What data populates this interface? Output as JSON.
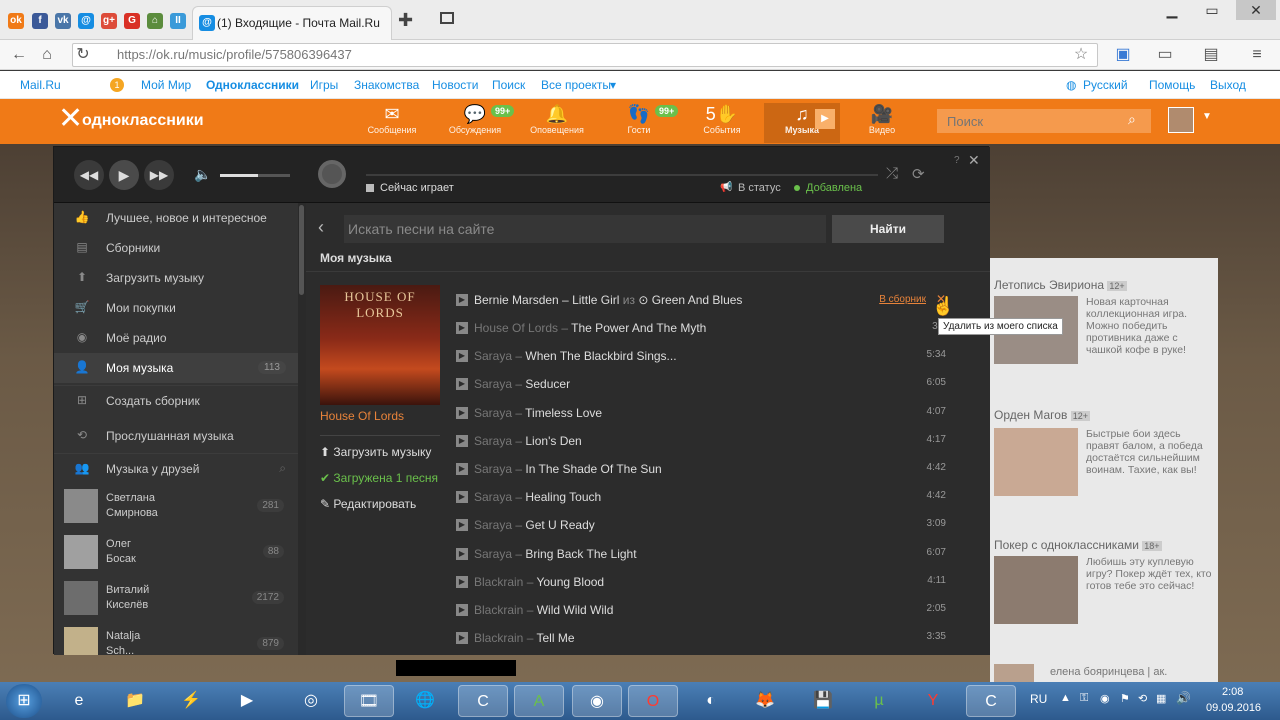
{
  "tabs": {
    "active_title": "(1) Входящие - Почта Mail.Ru"
  },
  "address": {
    "url": "https://ok.ru/music/profile/575806396437"
  },
  "mailbar": {
    "links": [
      "Mail.Ru",
      "Мой Мир",
      "Одноклассники",
      "Игры",
      "Знакомства",
      "Новости",
      "Поиск",
      "Все проекты"
    ],
    "language": "Русский",
    "help": "Помощь",
    "exit": "Выход"
  },
  "ok_header": {
    "logo": "одноклассники",
    "nav": [
      {
        "label": "Сообщения",
        "icon": "envelope-icon",
        "badge": ""
      },
      {
        "label": "Обсуждения",
        "icon": "chat-icon",
        "badge": "99+"
      },
      {
        "label": "Оповещения",
        "icon": "bell-icon",
        "badge": ""
      },
      {
        "label": "Гости",
        "icon": "footprints-icon",
        "badge": "99+"
      },
      {
        "label": "События",
        "icon": "events-icon",
        "badge": ""
      },
      {
        "label": "Музыка",
        "icon": "music-note-icon",
        "badge": ""
      },
      {
        "label": "Видео",
        "icon": "video-camera-icon",
        "badge": ""
      }
    ],
    "events_count": "5",
    "search_placeholder": "Поиск"
  },
  "player": {
    "now_playing": "Сейчас играет",
    "to_status": "В статус",
    "added": "Добавлена"
  },
  "sidebar": {
    "items": [
      {
        "label": "Лучшее, новое и интересное",
        "icon": "thumbs-up-icon"
      },
      {
        "label": "Сборники",
        "icon": "collection-icon"
      },
      {
        "label": "Загрузить музыку",
        "icon": "upload-icon"
      },
      {
        "label": "Мои покупки",
        "icon": "cart-icon"
      },
      {
        "label": "Моё радио",
        "icon": "radio-icon"
      },
      {
        "label": "Моя музыка",
        "icon": "user-music-icon",
        "count": "113"
      },
      {
        "label": "Создать сборник",
        "icon": "plus-square-icon"
      },
      {
        "label": "Прослушанная музыка",
        "icon": "history-icon"
      },
      {
        "label": "Музыка у друзей",
        "icon": "friends-icon"
      }
    ],
    "friends": [
      {
        "name1": "Светлана",
        "name2": "Смирнова",
        "count": "281"
      },
      {
        "name1": "Олег",
        "name2": "Босак",
        "count": "88"
      },
      {
        "name1": "Виталий",
        "name2": "Киселёв",
        "count": "2172"
      },
      {
        "name1": "Natalja",
        "name2": "Sch...",
        "count": "879"
      }
    ]
  },
  "content": {
    "search_placeholder": "Искать песни на сайте",
    "find_label": "Найти",
    "section_title": "Моя музыка",
    "album_art_text": "HOUSE OF LORDS",
    "album_name": "House Of Lords",
    "upload_label": "Загрузить музыку",
    "uploaded_label": "Загружена 1 песня",
    "edit_label": "Редактировать",
    "first_track": {
      "artist": "Bernie Marsden",
      "title": "Little Girl",
      "from": "из",
      "album": "Green And Blues",
      "to_collection": "В сборник"
    },
    "tooltip": "Удалить из моего списка",
    "tracks": [
      {
        "artist": "House Of Lords",
        "title": "The Power And The Myth",
        "duration": "3:2"
      },
      {
        "artist": "Saraya",
        "title": "When The Blackbird Sings...",
        "duration": "5:34"
      },
      {
        "artist": "Saraya",
        "title": "Seducer",
        "duration": "6:05"
      },
      {
        "artist": "Saraya",
        "title": "Timeless Love",
        "duration": "4:07"
      },
      {
        "artist": "Saraya",
        "title": "Lion's Den",
        "duration": "4:17"
      },
      {
        "artist": "Saraya",
        "title": "In The Shade Of The Sun",
        "duration": "4:42"
      },
      {
        "artist": "Saraya",
        "title": "Healing Touch",
        "duration": "4:42"
      },
      {
        "artist": "Saraya",
        "title": "Get U Ready",
        "duration": "3:09"
      },
      {
        "artist": "Saraya",
        "title": "Bring Back The Light",
        "duration": "6:07"
      },
      {
        "artist": "Blackrain",
        "title": "Young Blood",
        "duration": "4:11"
      },
      {
        "artist": "Blackrain",
        "title": "Wild Wild Wild",
        "duration": "2:05"
      },
      {
        "artist": "Blackrain",
        "title": "Tell Me",
        "duration": "3:35"
      }
    ]
  },
  "right_ads": [
    {
      "title": "Летопись Эвириона",
      "age": "12+",
      "text": "Новая карточная коллекционная игра. Можно победить противника даже с чашкой кофе в руке!"
    },
    {
      "title": "Орден Магов",
      "age": "12+",
      "text": "Быстрые бои здесь правят балом, а победа достаётся сильнейшим воинам. Тахие, как вы!"
    },
    {
      "title": "Покер с одноклассниками",
      "age": "18+",
      "text": "Любишь эту куплевую игру? Покер ждёт тех, кто готов тебе это сейчас!"
    }
  ],
  "footer_text": "елена бояринцева | ак.",
  "taskbar": {
    "lang": "RU",
    "time": "2:08",
    "date": "09.09.2016"
  }
}
